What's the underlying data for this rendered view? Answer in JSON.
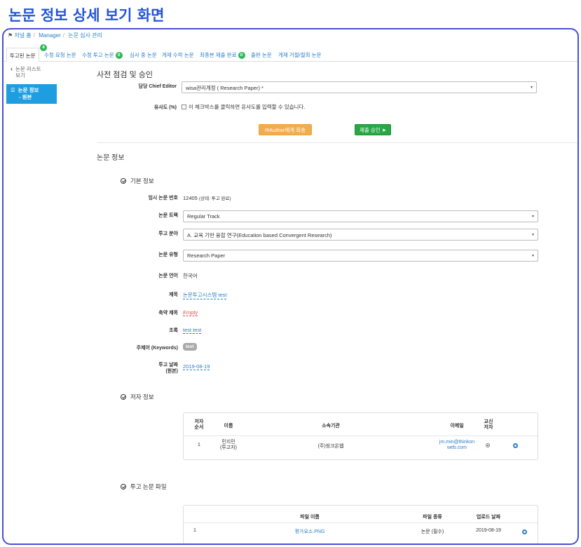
{
  "heading": "논문 정보 상세 보기 화면",
  "breadcrumb": {
    "home": "저널 홈",
    "manager": "Manager",
    "current": "논문 심사 관리"
  },
  "tabs": [
    {
      "label": "투고된 논문",
      "badge": "4"
    },
    {
      "label": "수정 요청 논문"
    },
    {
      "label": "수정 투고 논문",
      "badge": "0"
    },
    {
      "label": "심사 중 논문"
    },
    {
      "label": "게재 수락 논문"
    },
    {
      "label": "최종본 제출 완료",
      "badge": "0"
    },
    {
      "label": "출판 논문"
    },
    {
      "label": "게재 거절/철회 논문"
    }
  ],
  "left_nav": {
    "back_label": "논문 리스트 보기",
    "active_label_1": "논문 정보",
    "active_label_2": "- 원본"
  },
  "precheck": {
    "title": "사전 점검 및 승인",
    "editor_label": "담당 Chief Editor",
    "editor_value": "wisa관리계정 ( Research Paper) *",
    "similarity_label": "유사도 (%)",
    "similarity_hint": "이 체크박스를 클릭하면 유사도를 입력할 수 있습니다.",
    "return_button": "Author에게 회송",
    "approve_button": "제출 승인"
  },
  "paper": {
    "title": "논문 정보",
    "basic_title": "기본 정보",
    "fields": {
      "temp_no_label": "임시 논문 번호",
      "temp_no_value": "12405",
      "temp_no_status": "(상태: 투고 완료)",
      "track_label": "논문 트랙",
      "track_value": "Regular Track",
      "field_label": "투고 분야",
      "field_value": "A. 교육 기반 융합 연구(Education based Convergent Research)",
      "type_label": "논문 유형",
      "type_value": "Research Paper",
      "lang_label": "논문 언어",
      "lang_value": "한국어",
      "title_label": "제목",
      "title_value": "논문투고시스템 test",
      "short_title_label": "축약 제목",
      "short_title_value": "Empty",
      "abstract_label": "초록",
      "abstract_value": "test test",
      "keywords_label": "주제어 (Keywords)",
      "keywords_value": "test",
      "date_label_1": "투고 날짜",
      "date_label_2": "(원본)",
      "date_value": "2019-08-19"
    },
    "authors": {
      "title": "저자 정보",
      "headers": {
        "order_1": "저자",
        "order_2": "순서",
        "name": "이름",
        "affiliation": "소속기관",
        "email": "이메일",
        "corr_1": "교신",
        "corr_2": "저자"
      },
      "rows": [
        {
          "order": "1",
          "name_1": "민지민",
          "name_2": "(투고자)",
          "affiliation": "(주)씽크온웹",
          "email_1": "jm.min@thinkon",
          "email_2": "web.com"
        }
      ]
    },
    "files": {
      "title": "투고 논문 파일",
      "headers": {
        "name": "파일 이름",
        "kind": "파일 종류",
        "date": "업로드 날짜"
      },
      "rows": [
        {
          "no": "1",
          "name": "평가요소.PNG",
          "kind": "논문 (필수)",
          "date": "2019-08-19"
        }
      ]
    }
  },
  "colors": {
    "accent": "#2a7fc9",
    "heading": "#2355d8",
    "frame": "#4b4ed8",
    "nav_active": "#1e9ee0",
    "badge": "#2fb85a",
    "orange": "#f0ad4e",
    "green": "#28a745"
  }
}
